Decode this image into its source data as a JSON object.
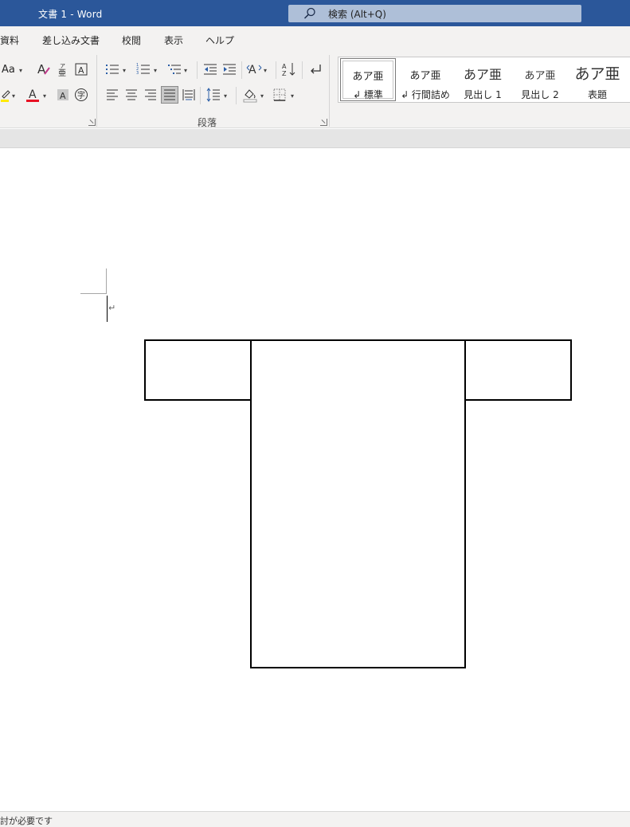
{
  "titlebar": {
    "title": "文書 1  -  Word",
    "search_placeholder": "検索 (Alt+Q)"
  },
  "menu": {
    "tabs": [
      "資料",
      "差し込み文書",
      "校閲",
      "表示",
      "ヘルプ"
    ]
  },
  "ribbon": {
    "font_group": {
      "change_case_label": "Aa",
      "font_color": "#e81123",
      "highlight_color": "#ffea00"
    },
    "paragraph_group": {
      "label": "段落"
    },
    "styles": [
      {
        "sample": "あア亜",
        "name": "↲ 標準"
      },
      {
        "sample": "あア亜",
        "name": "↲ 行間詰め"
      },
      {
        "sample": "あア亜",
        "name": "見出し 1"
      },
      {
        "sample": "あア亜",
        "name": "見出し 2"
      },
      {
        "sample": "あア亜",
        "name": "表題"
      }
    ]
  },
  "document": {
    "paragraph_mark": "↵"
  },
  "statusbar": {
    "text": "討が必要です"
  },
  "colors": {
    "titlebar": "#2b579a",
    "ribbon": "#f3f2f1",
    "search_box": "#aebfd8"
  }
}
